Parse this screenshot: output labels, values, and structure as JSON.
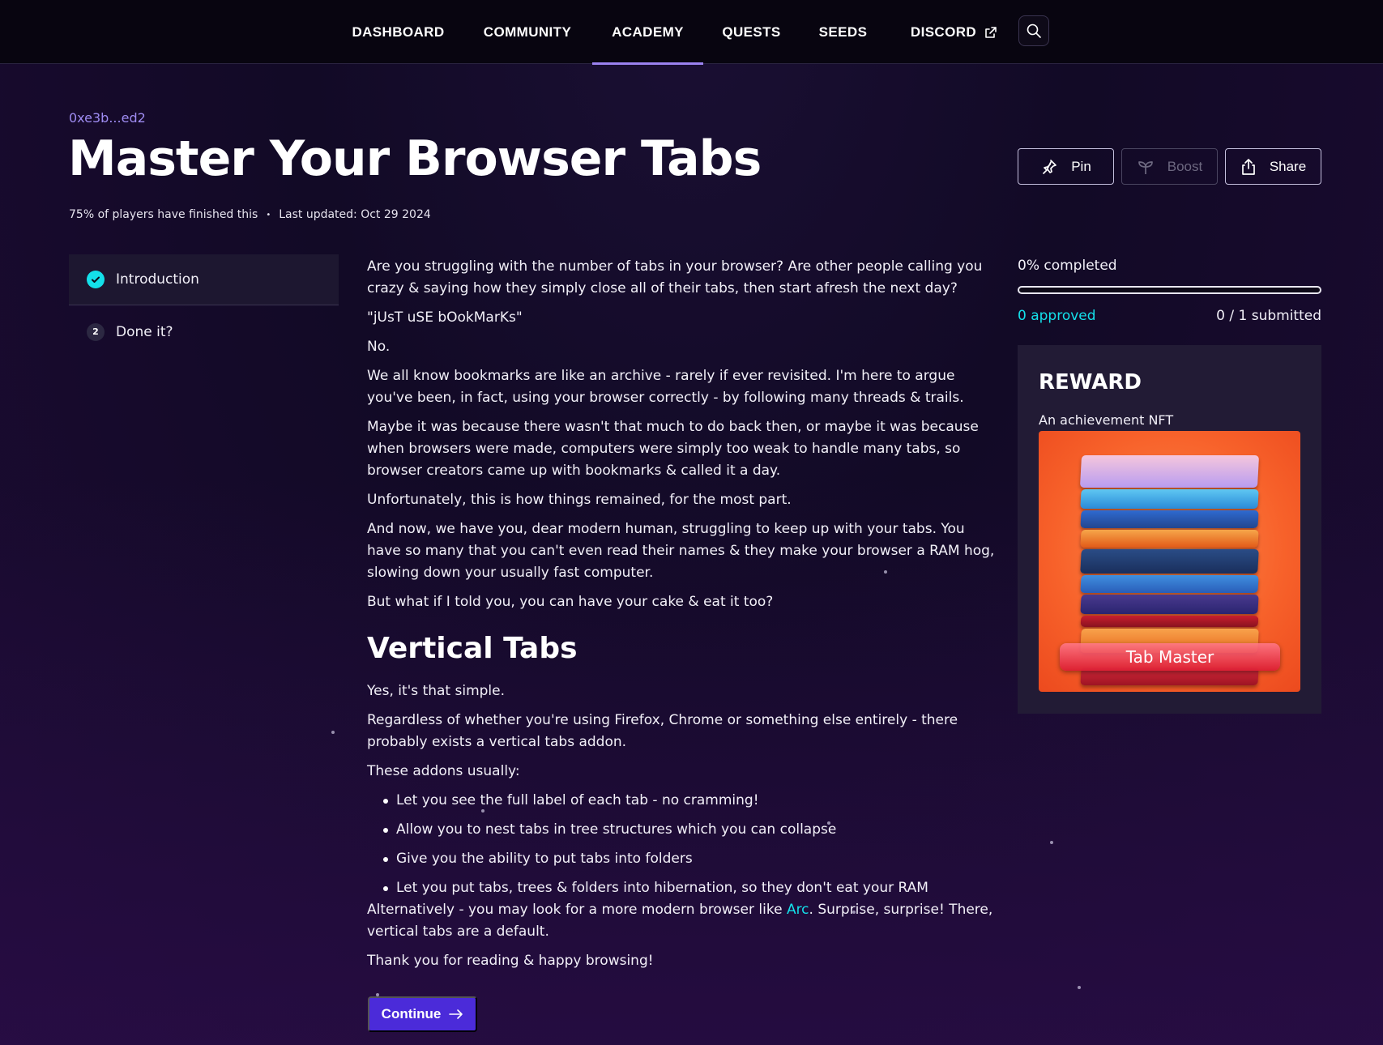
{
  "nav": {
    "items": [
      {
        "label": "DASHBOARD"
      },
      {
        "label": "COMMUNITY"
      },
      {
        "label": "ACADEMY"
      },
      {
        "label": "QUESTS"
      },
      {
        "label": "SEEDS"
      },
      {
        "label": "DISCORD"
      }
    ],
    "active": "ACADEMY",
    "discord_icon": "external-link-icon",
    "search_icon": "search-icon"
  },
  "header": {
    "author": "0xe3b...ed2",
    "title": "Master Your Browser Tabs",
    "completion_text": "75% of players have finished this",
    "updated_text": "Last updated: Oct 29 2024",
    "actions": {
      "pin": "Pin",
      "boost": "Boost",
      "share": "Share"
    }
  },
  "steps": [
    {
      "number": "1",
      "label": "Introduction",
      "status": "completed"
    },
    {
      "number": "2",
      "label": "Done it?",
      "status": "pending"
    }
  ],
  "article": {
    "p1": "Are you struggling with the number of tabs in your browser? Are other people calling you crazy & saying how they simply close all of their tabs, then start afresh the next day?",
    "p2": "\"jUsT uSE bOokMarKs\"",
    "p3": "No.",
    "p4": "We all know bookmarks are like an archive - rarely if ever revisited. I'm here to argue you've been, in fact, using your browser correctly - by following many threads & trails.",
    "p5": "Maybe it was because there wasn't that much to do back then, or maybe it was because when browsers were made, computers were simply too weak to handle many tabs, so browser creators came up with bookmarks & called it a day.",
    "p6": "Unfortunately, this is how things remained, for the most part.",
    "p7": "And now, we have you, dear modern human, struggling to keep up with your tabs. You have so many that you can't even read their names & they make your browser a RAM hog, slowing down your usually fast computer.",
    "p8": "But what if I told you, you can have your cake & eat it too?",
    "heading": "Vertical Tabs",
    "p9": "Yes, it's that simple.",
    "p10": "Regardless of whether you're using Firefox, Chrome or something else entirely - there probably exists a vertical tabs addon.",
    "p11": "These addons usually:",
    "bullets": [
      "Let you see the full label of each tab - no cramming!",
      "Allow you to nest tabs in tree structures which you can collapse",
      "Give you the ability to put tabs into folders",
      "Let you put tabs, trees & folders into hibernation, so they don't eat your RAM"
    ],
    "p12_before": "Alternatively - you may look for a more modern browser like ",
    "p12_link": "Arc",
    "p12_after": ". Surprise, surprise! There, vertical tabs are a default.",
    "p13": "Thank you for reading & happy browsing!",
    "continue_label": "Continue"
  },
  "progress": {
    "label": "0% completed",
    "fraction": 0,
    "approved": "0 approved",
    "submitted": "0 / 1 submitted"
  },
  "reward": {
    "title": "REWARD",
    "subtitle": "An achievement NFT",
    "nft_label": "Tab Master"
  },
  "colors": {
    "accent_cyan": "#14e0ea",
    "accent_purple": "#9b82f0",
    "button_primary": "#4b2bd9",
    "nft_orange": "#f7612a"
  }
}
